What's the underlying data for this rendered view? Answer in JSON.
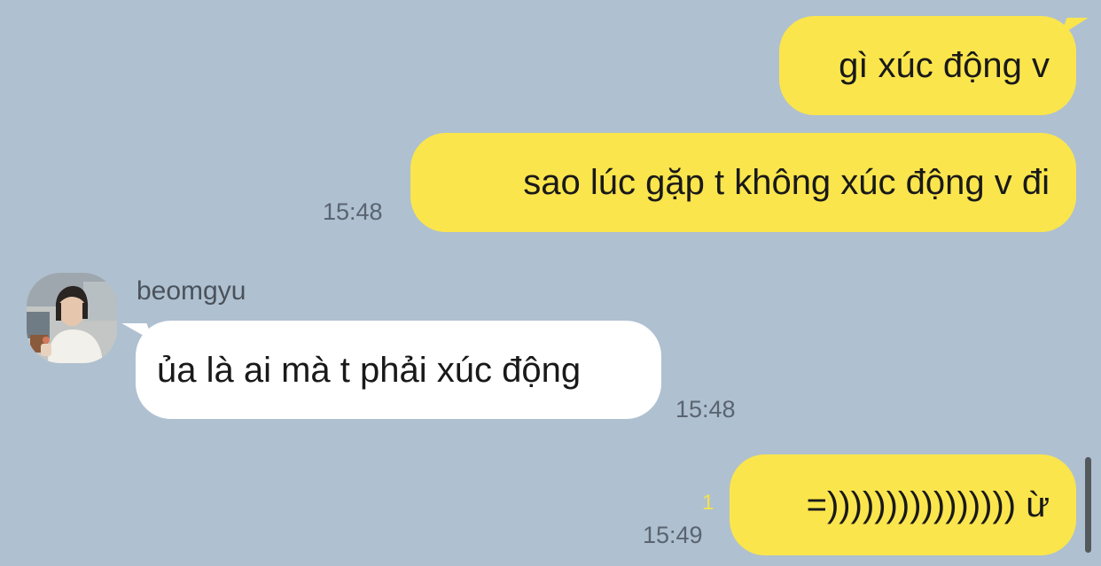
{
  "messages": [
    {
      "from": "me",
      "text": "gì xúc động v"
    },
    {
      "from": "me",
      "text": "sao lúc gặp t không xúc động v đi",
      "time": "15:48"
    },
    {
      "from": "beomgyu",
      "sender": "beomgyu",
      "text": "ủa là ai mà t phải xúc động",
      "time": "15:48"
    },
    {
      "from": "me",
      "text": "=)))))))))))))))) ừ",
      "time": "15:49",
      "unread": "1"
    }
  ],
  "colors": {
    "background": "#AFC0D0",
    "outgoing_bubble": "#FAE54D",
    "incoming_bubble": "#FFFFFF",
    "unread_count": "#F4E24A"
  },
  "icons": {
    "avatar": "user-avatar-photo"
  }
}
